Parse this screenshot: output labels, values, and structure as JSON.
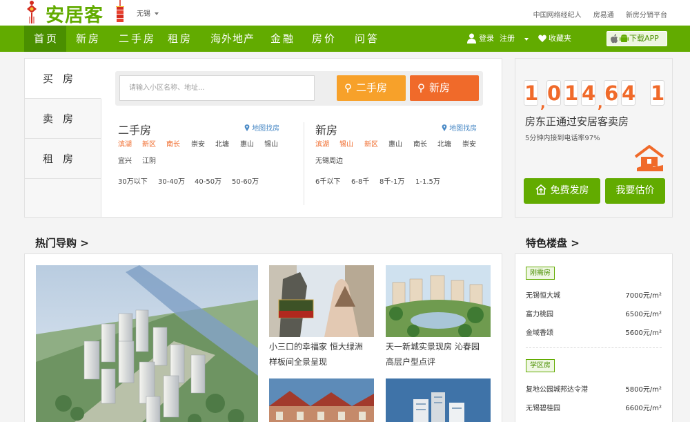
{
  "brand": {
    "logo_text": "安居客",
    "accent": "#62ab00",
    "orange": "#f06a2a"
  },
  "city": "无锡",
  "top_links": [
    "中国网络经纪人",
    "房易通",
    "新房分销平台"
  ],
  "nav": {
    "items": [
      "首页",
      "新房",
      "二手房",
      "租房",
      "海外地产",
      "金融",
      "房价",
      "问答"
    ],
    "login": "登录",
    "register": "注册",
    "favorites": "收藏夹",
    "app": "下载APP"
  },
  "search": {
    "tabs": [
      "买房",
      "卖房",
      "租房"
    ],
    "placeholder": "请输入小区名称、地址...",
    "btn_second": "二手房",
    "btn_new": "新房",
    "left": {
      "title": "二手房",
      "map": "地图找房",
      "areas": [
        "滨湖",
        "新区",
        "南长",
        "崇安",
        "北塘",
        "惠山",
        "锡山",
        "宜兴",
        "江阴"
      ],
      "prices": [
        "30万以下",
        "30-40万",
        "40-50万",
        "50-60万"
      ]
    },
    "right": {
      "title": "新房",
      "map": "地图找房",
      "areas": [
        "滨湖",
        "锡山",
        "新区",
        "惠山",
        "南长",
        "北塘",
        "崇安",
        "无锡周边"
      ],
      "prices": [
        "6千以下",
        "6-8千",
        "8千-1万",
        "1-1.5万"
      ]
    }
  },
  "owner_card": {
    "count_digits": [
      "1",
      "0",
      "1",
      "4",
      "6",
      "4",
      "1"
    ],
    "title": "房东正通过安居客卖房",
    "subtitle": "5分钟内接到电话率97%",
    "btn_post": "免费发房",
    "btn_estimate": "我要估价"
  },
  "hot": {
    "title": "热门导购 >",
    "captions": [
      [
        "小三口的幸福家 恒大绿洲",
        "样板间全景呈现"
      ],
      [
        "天一新城实景现房 沁春园",
        "高层户型点评"
      ]
    ]
  },
  "featured": {
    "title": "特色楼盘 >",
    "groups": [
      {
        "badge": "刚需房",
        "rows": [
          {
            "name": "无锡恒大城",
            "price": "7000元/m²"
          },
          {
            "name": "富力桃园",
            "price": "6500元/m²"
          },
          {
            "name": "金域香颂",
            "price": "5600元/m²"
          }
        ]
      },
      {
        "badge": "学区房",
        "rows": [
          {
            "name": "复地公园城邦达令港",
            "price": "5800元/m²"
          },
          {
            "name": "无锡碧桂园",
            "price": "6600元/m²"
          }
        ]
      }
    ]
  }
}
